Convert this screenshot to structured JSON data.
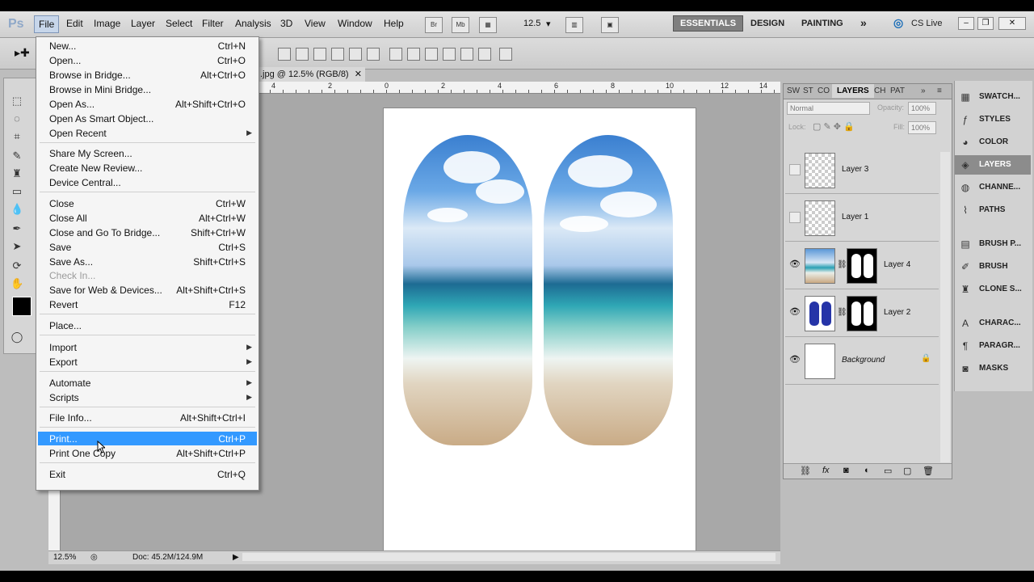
{
  "menubar": {
    "logo": "Ps",
    "items": [
      "File",
      "Edit",
      "Image",
      "Layer",
      "Select",
      "Filter",
      "Analysis",
      "3D",
      "View",
      "Window",
      "Help"
    ],
    "icons": {
      "bridge": "Br",
      "minibridge": "Mb"
    },
    "zoom": "12.5",
    "workspaces": [
      "ESSENTIALS",
      "DESIGN",
      "PAINTING"
    ],
    "more": "»",
    "cslive": "CS Live"
  },
  "document": {
    "tab_title": ".jpg @ 12.5% (RGB/8)",
    "status_zoom": "12.5%",
    "status_doc": "Doc: 45.2M/124.9M",
    "ruler_numbers": [
      "4",
      "2",
      "0",
      "2",
      "4",
      "6",
      "8",
      "10",
      "12",
      "14"
    ]
  },
  "file_menu": {
    "groups": [
      [
        {
          "label": "New...",
          "shortcut": "Ctrl+N"
        },
        {
          "label": "Open...",
          "shortcut": "Ctrl+O"
        },
        {
          "label": "Browse in Bridge...",
          "shortcut": "Alt+Ctrl+O"
        },
        {
          "label": "Browse in Mini Bridge...",
          "shortcut": ""
        },
        {
          "label": "Open As...",
          "shortcut": "Alt+Shift+Ctrl+O"
        },
        {
          "label": "Open As Smart Object...",
          "shortcut": ""
        },
        {
          "label": "Open Recent",
          "shortcut": "",
          "submenu": true
        }
      ],
      [
        {
          "label": "Share My Screen...",
          "shortcut": ""
        },
        {
          "label": "Create New Review...",
          "shortcut": ""
        },
        {
          "label": "Device Central...",
          "shortcut": ""
        }
      ],
      [
        {
          "label": "Close",
          "shortcut": "Ctrl+W"
        },
        {
          "label": "Close All",
          "shortcut": "Alt+Ctrl+W"
        },
        {
          "label": "Close and Go To Bridge...",
          "shortcut": "Shift+Ctrl+W"
        },
        {
          "label": "Save",
          "shortcut": "Ctrl+S"
        },
        {
          "label": "Save As...",
          "shortcut": "Shift+Ctrl+S"
        },
        {
          "label": "Check In...",
          "shortcut": "",
          "disabled": true
        },
        {
          "label": "Save for Web & Devices...",
          "shortcut": "Alt+Shift+Ctrl+S"
        },
        {
          "label": "Revert",
          "shortcut": "F12"
        }
      ],
      [
        {
          "label": "Place...",
          "shortcut": ""
        }
      ],
      [
        {
          "label": "Import",
          "shortcut": "",
          "submenu": true
        },
        {
          "label": "Export",
          "shortcut": "",
          "submenu": true
        }
      ],
      [
        {
          "label": "Automate",
          "shortcut": "",
          "submenu": true
        },
        {
          "label": "Scripts",
          "shortcut": "",
          "submenu": true
        }
      ],
      [
        {
          "label": "File Info...",
          "shortcut": "Alt+Shift+Ctrl+I"
        }
      ],
      [
        {
          "label": "Print...",
          "shortcut": "Ctrl+P",
          "highlighted": true
        },
        {
          "label": "Print One Copy",
          "shortcut": "Alt+Shift+Ctrl+P"
        }
      ],
      [
        {
          "label": "Exit",
          "shortcut": "Ctrl+Q"
        }
      ]
    ]
  },
  "layers_panel": {
    "tabs": [
      "SW",
      "ST",
      "CO",
      "LAYERS",
      "CH",
      "PAT"
    ],
    "blend_mode": "Normal",
    "opacity_label": "Opacity:",
    "opacity": "100%",
    "lock_label": "Lock:",
    "fill_label": "Fill:",
    "fill": "100%",
    "layers": [
      {
        "name": "Layer 3",
        "visible": false,
        "thumb": "checker"
      },
      {
        "name": "Layer 1",
        "visible": false,
        "thumb": "checker"
      },
      {
        "name": "Layer 4",
        "visible": true,
        "thumb": "beach",
        "mask": true
      },
      {
        "name": "Layer 2",
        "visible": true,
        "thumb": "blue",
        "mask": true
      },
      {
        "name": "Background",
        "visible": true,
        "thumb": "white",
        "locked": true
      }
    ]
  },
  "dock": {
    "items": [
      "SWATCH...",
      "STYLES",
      "COLOR",
      "LAYERS",
      "CHANNE...",
      "PATHS",
      "BRUSH P...",
      "BRUSH",
      "CLONE S...",
      "CHARAC...",
      "PARAGR...",
      "MASKS"
    ],
    "active": "LAYERS"
  },
  "colors": {
    "menu_highlight": "#3399ff",
    "workspace_active": "#7f7f7f",
    "ui_gray": "#d6d6d6"
  }
}
